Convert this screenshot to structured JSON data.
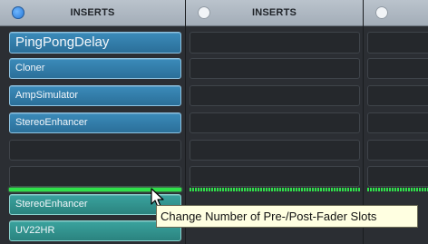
{
  "columns": [
    {
      "header": {
        "label": "INSERTS",
        "power_on": true
      },
      "slots": [
        {
          "name": "PingPongDelay",
          "state": "filled",
          "large": true
        },
        {
          "name": "Cloner",
          "state": "filled"
        },
        {
          "name": "AmpSimulator",
          "state": "filled"
        },
        {
          "name": "StereoEnhancer",
          "state": "filled"
        },
        {
          "name": "",
          "state": "empty"
        },
        {
          "name": "",
          "state": "empty"
        },
        {
          "name": "StereoEnhancer",
          "state": "filled-post"
        },
        {
          "name": "UV22HR",
          "state": "filled-post"
        }
      ]
    },
    {
      "header": {
        "label": "INSERTS",
        "power_on": false
      },
      "slots": [
        {
          "name": "",
          "state": "empty"
        },
        {
          "name": "",
          "state": "empty"
        },
        {
          "name": "",
          "state": "empty"
        },
        {
          "name": "",
          "state": "empty"
        },
        {
          "name": "",
          "state": "empty"
        },
        {
          "name": "",
          "state": "empty"
        }
      ]
    },
    {
      "header": {
        "label": "",
        "power_on": false
      },
      "slots": [
        {
          "name": "",
          "state": "empty"
        },
        {
          "name": "",
          "state": "empty"
        },
        {
          "name": "",
          "state": "empty"
        },
        {
          "name": "",
          "state": "empty"
        },
        {
          "name": "",
          "state": "empty"
        },
        {
          "name": "",
          "state": "empty"
        }
      ]
    }
  ],
  "tooltip": {
    "text": "Change Number of Pre-/Post-Fader Slots"
  },
  "colors": {
    "slot_pre": "#2f7ba8",
    "slot_post": "#2f948f",
    "divider": "#2fe04a",
    "header": "#b0b9c3",
    "tooltip_bg": "#ffffe1"
  }
}
